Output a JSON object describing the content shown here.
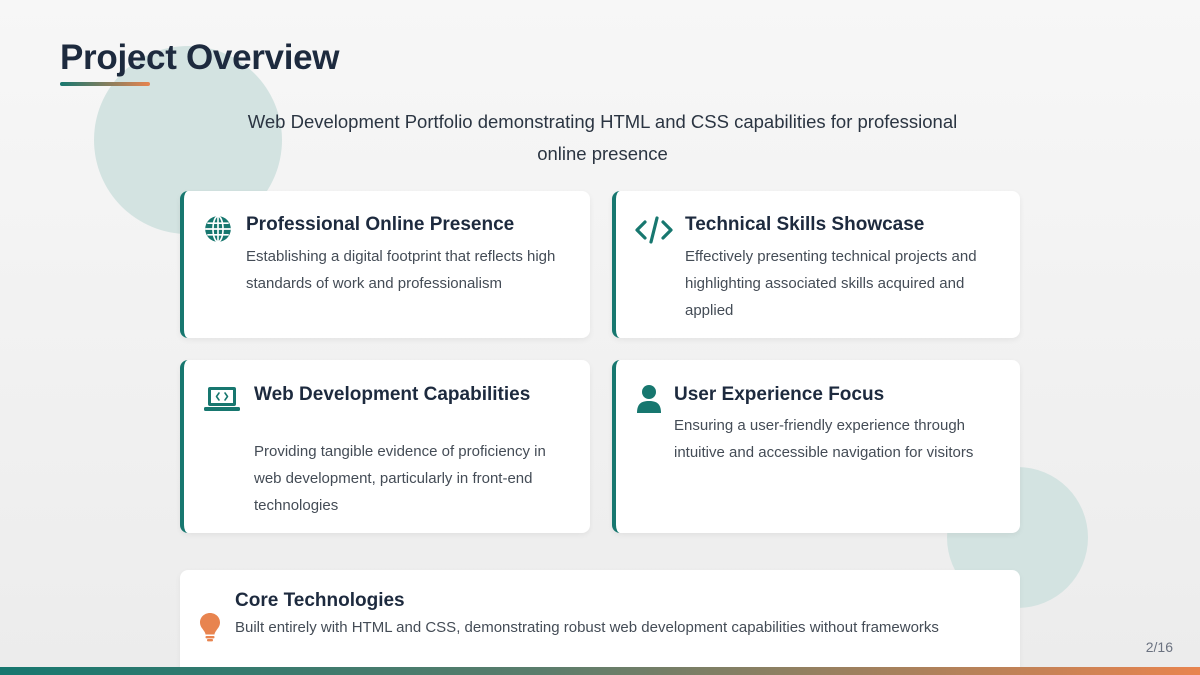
{
  "slide": {
    "title": "Project Overview",
    "subtitle": "Web Development Portfolio demonstrating HTML and CSS capabilities for professional online presence",
    "page_number": "2/16"
  },
  "colors": {
    "accent_teal": "#17776f",
    "accent_orange": "#e8844f",
    "heading": "#1d2a3e",
    "decor_circle": "#d3e3e1"
  },
  "cards": [
    {
      "icon": "globe-icon",
      "title": "Professional Online Presence",
      "description": "Establishing a digital footprint that reflects high standards of work and professionalism"
    },
    {
      "icon": "code-icon",
      "title": "Technical Skills Showcase",
      "description": "Effectively presenting technical projects and highlighting associated skills acquired and applied"
    },
    {
      "icon": "laptop-code-icon",
      "title": "Web Development Capabilities",
      "description": "Providing tangible evidence of proficiency in web development, particularly in front-end technologies"
    },
    {
      "icon": "user-icon",
      "title": "User Experience Focus",
      "description": "Ensuring a user-friendly experience through intuitive and accessible navigation for visitors"
    }
  ],
  "core": {
    "icon": "lightbulb-icon",
    "title": "Core Technologies",
    "description": "Built entirely with HTML and CSS, demonstrating robust web development capabilities without frameworks"
  }
}
